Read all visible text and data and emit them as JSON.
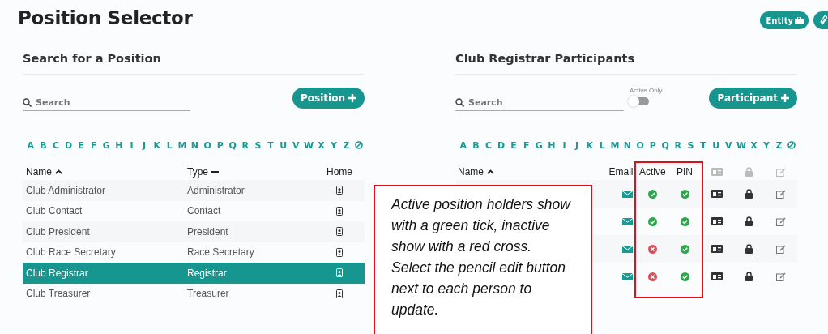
{
  "title": "Position Selector",
  "entity_button": {
    "label": "Entity"
  },
  "positions_panel": {
    "heading": "Search for a Position",
    "search": {
      "placeholder": "Search"
    },
    "add_button": "Position",
    "alphabet": [
      "A",
      "B",
      "C",
      "D",
      "E",
      "F",
      "G",
      "H",
      "I",
      "J",
      "K",
      "L",
      "M",
      "N",
      "O",
      "P",
      "Q",
      "R",
      "S",
      "T",
      "U",
      "V",
      "W",
      "X",
      "Y",
      "Z"
    ],
    "columns": [
      "Name",
      "Type",
      "Home"
    ],
    "rows": [
      {
        "name": "Club Administrator",
        "type": "Administrator",
        "selected": false
      },
      {
        "name": "Club Contact",
        "type": "Contact",
        "selected": false
      },
      {
        "name": "Club President",
        "type": "President",
        "selected": false
      },
      {
        "name": "Club Race Secretary",
        "type": "Race Secretary",
        "selected": false
      },
      {
        "name": "Club Registrar",
        "type": "Registrar",
        "selected": true
      },
      {
        "name": "Club Treasurer",
        "type": "Treasurer",
        "selected": false
      }
    ]
  },
  "participants_panel": {
    "heading": "Club Registrar Participants",
    "search": {
      "placeholder": "Search"
    },
    "active_only": {
      "label": "Active Only",
      "on": false
    },
    "add_button": "Participant",
    "alphabet": [
      "A",
      "B",
      "C",
      "D",
      "E",
      "F",
      "G",
      "H",
      "I",
      "J",
      "K",
      "L",
      "M",
      "N",
      "O",
      "P",
      "Q",
      "R",
      "S",
      "T",
      "U",
      "V",
      "W",
      "X",
      "Y",
      "Z"
    ],
    "columns": [
      "Name",
      "Email",
      "Active",
      "PIN"
    ],
    "rows": [
      {
        "active": true,
        "pin": true
      },
      {
        "active": true,
        "pin": true
      },
      {
        "active": false,
        "pin": true
      },
      {
        "active": false,
        "pin": true
      }
    ]
  },
  "callout": {
    "text": "Active position holders show with a green tick, inactive show with a red cross. Select the pencil edit button next to each person to update."
  }
}
